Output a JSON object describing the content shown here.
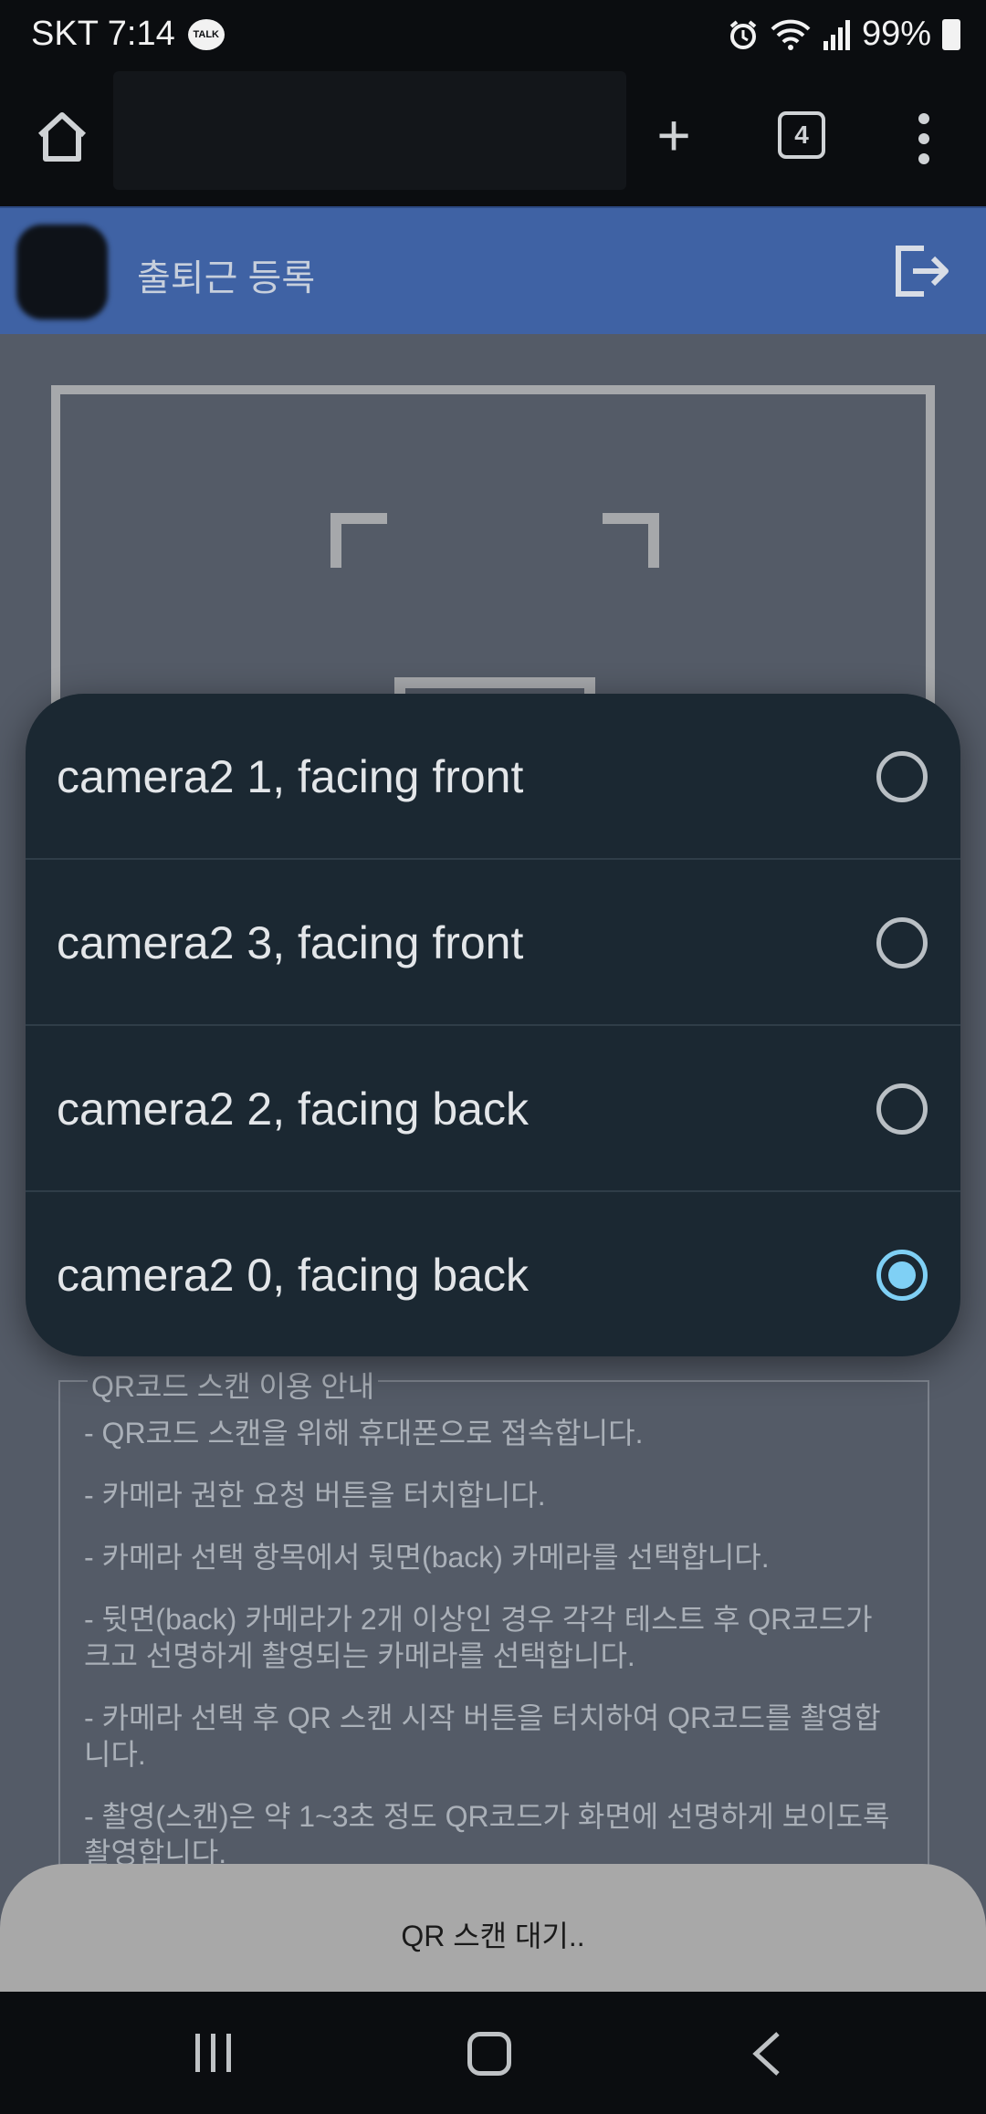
{
  "status_bar": {
    "carrier_time": "SKT 7:14",
    "talk_badge": "TALK",
    "battery": "99%"
  },
  "browser": {
    "tab_count": "4",
    "plus": "+"
  },
  "header": {
    "title": "출퇴근 등록"
  },
  "camera_dialog": {
    "options": [
      {
        "label": "camera2 1, facing front",
        "selected": false
      },
      {
        "label": "camera2 3, facing front",
        "selected": false
      },
      {
        "label": "camera2 2, facing back",
        "selected": false
      },
      {
        "label": "camera2 0, facing back",
        "selected": true
      }
    ]
  },
  "guide": {
    "legend": "QR코드 스캔 이용 안내",
    "items": [
      "- QR코드 스캔을 위해 휴대폰으로 접속합니다.",
      "- 카메라 권한 요청 버튼을 터치합니다.",
      "- 카메라 선택 항목에서 뒷면(back) 카메라를 선택합니다.",
      "- 뒷면(back) 카메라가 2개 이상인 경우 각각 테스트 후 QR코드가 크고 선명하게 촬영되는 카메라를 선택합니다.",
      "- 카메라 선택 후 QR 스캔 시작 버튼을 터치하여 QR코드를 촬영합니다.",
      "- 촬영(스캔)은 약 1~3초 정도 QR코드가 화면에 선명하게 보이도록 촬영합니다."
    ]
  },
  "bottom_status": "QR 스캔 대기..",
  "colors": {
    "header_bg": "#3f62a4",
    "dialog_bg": "#1b2832",
    "radio_selected": "#7fd0f5"
  }
}
